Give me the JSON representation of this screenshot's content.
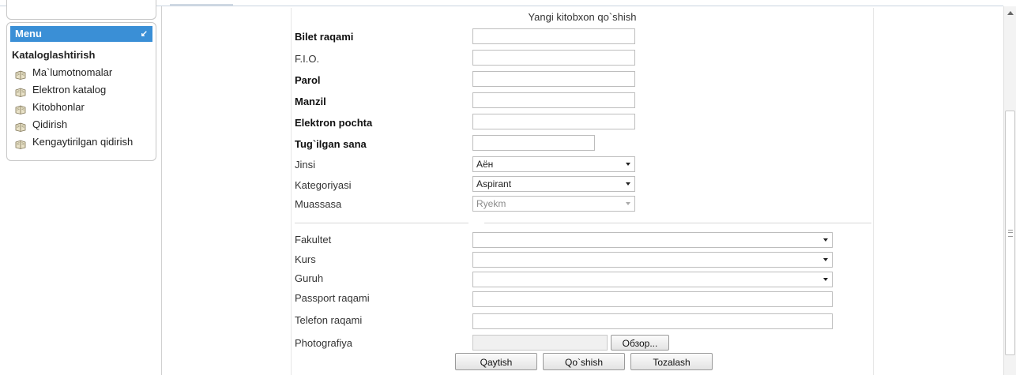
{
  "sidebar": {
    "menu_label": "Menu",
    "menu_arrow": "↙",
    "category_title": "Kataloglashtirish",
    "items": [
      {
        "label": "Ma`lumotnomalar",
        "icon": "book-icon"
      },
      {
        "label": "Elektron katalog",
        "icon": "book-icon"
      },
      {
        "label": "Kitobhonlar",
        "icon": "book-icon"
      },
      {
        "label": "Qidirish",
        "icon": "book-icon"
      },
      {
        "label": "Kengaytirilgan qidirish",
        "icon": "book-icon"
      }
    ]
  },
  "form": {
    "title": "Yangi kitobxon qo`shish",
    "bilet_label": "Bilet raqami",
    "bilet_value": "",
    "fio_label": "F.I.O.",
    "fio_value": "",
    "parol_label": "Parol",
    "parol_value": "",
    "manzil_label": "Manzil",
    "manzil_value": "",
    "email_label": "Elektron pochta",
    "email_value": "",
    "birth_label": "Tug`ilgan sana",
    "birth_value": "",
    "jinsi_label": "Jinsi",
    "jinsi_value": "Аён",
    "kategoriya_label": "Kategoriyasi",
    "kategoriya_value": "Aspirant",
    "muassasa_label": "Muassasa",
    "muassasa_value": "Ryekm",
    "fakultet_label": "Fakultet",
    "fakultet_value": "",
    "kurs_label": "Kurs",
    "kurs_value": "",
    "guruh_label": "Guruh",
    "guruh_value": "",
    "passport_label": "Passport raqami",
    "passport_value": "",
    "telefon_label": "Telefon raqami",
    "telefon_value": "",
    "photo_label": "Photografiya",
    "browse_label": "Обзор..."
  },
  "buttons": {
    "back": "Qaytish",
    "add": "Qo`shish",
    "clear": "Tozalash"
  },
  "colors": {
    "menu_header": "#3a8fd6"
  }
}
